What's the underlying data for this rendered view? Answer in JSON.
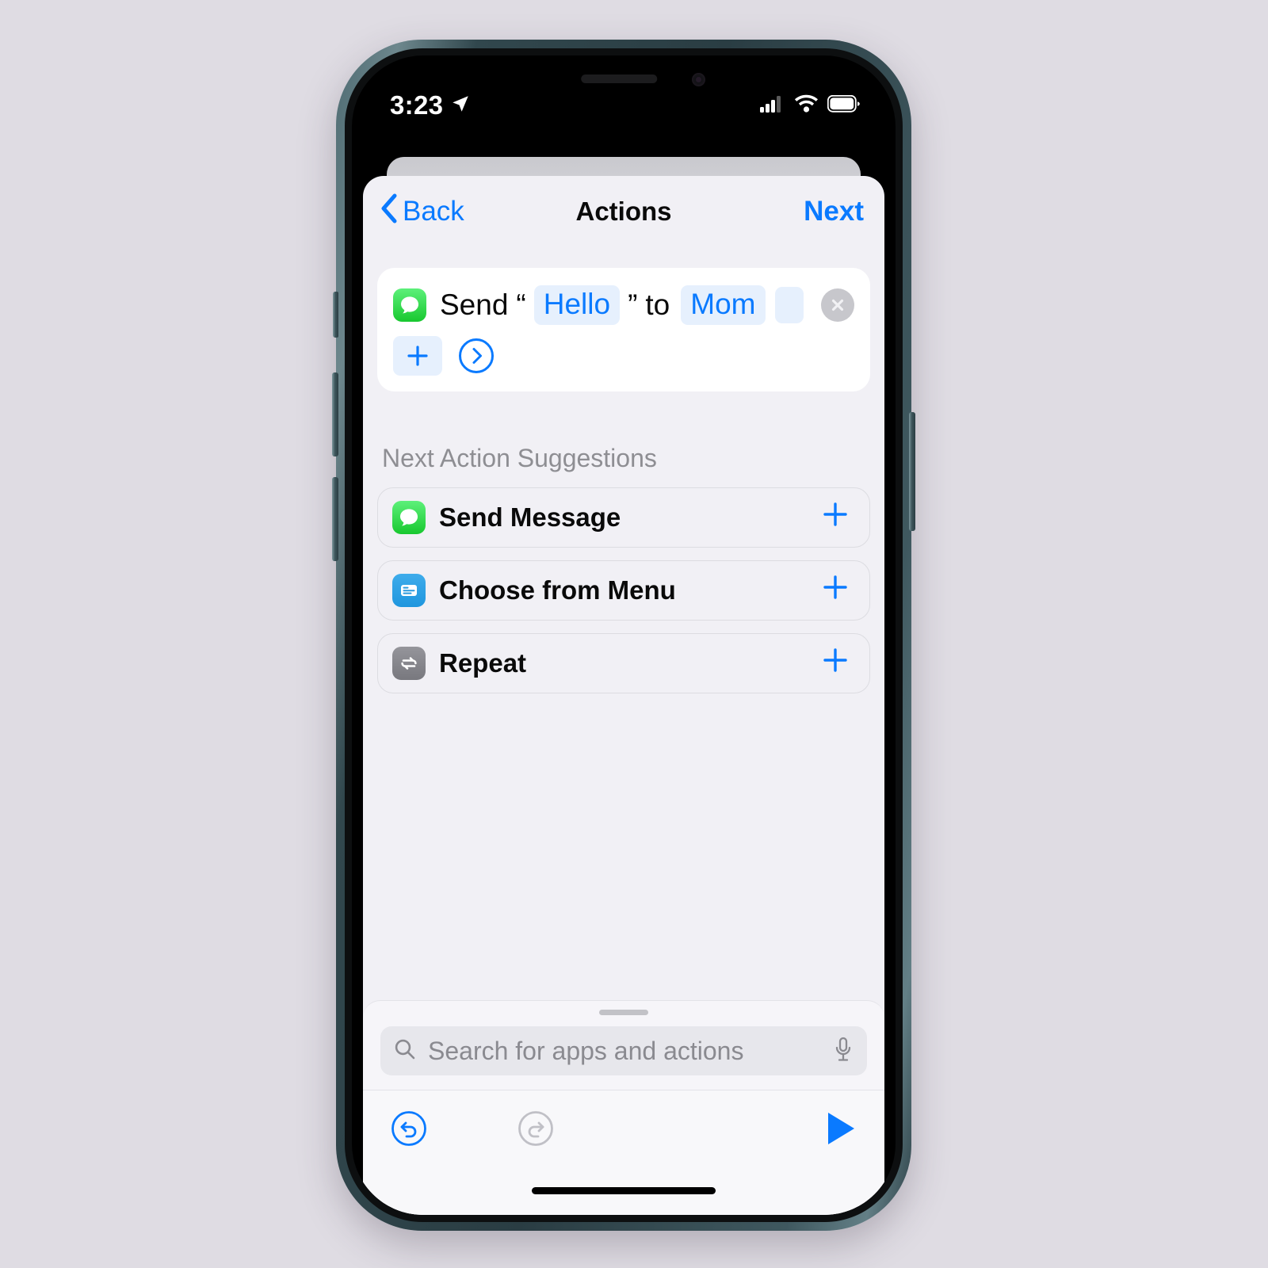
{
  "status_bar": {
    "time": "3:23",
    "location_icon": "location-arrow-icon",
    "cellular_icon": "cellular-signal-icon",
    "wifi_icon": "wifi-icon",
    "battery_icon": "battery-icon",
    "signal_bars_filled": 3,
    "signal_bars_total": 4
  },
  "nav": {
    "back_label": "Back",
    "title": "Actions",
    "next_label": "Next",
    "accent_color": "#0a7aff"
  },
  "action_card": {
    "app_icon": "messages-icon",
    "verb": "Send",
    "quote_open": "“",
    "message_value": "Hello",
    "quote_close": "”",
    "preposition": "to",
    "recipient_value": "Mom",
    "empty_field_value": "",
    "delete_icon": "close-circle-icon",
    "add_variable_icon": "plus-icon",
    "expand_icon": "chevron-right-circle-icon"
  },
  "suggestions": {
    "header": "Next Action Suggestions",
    "items": [
      {
        "label": "Send Message",
        "icon": "messages-icon",
        "add_icon": "plus-icon"
      },
      {
        "label": "Choose from Menu",
        "icon": "menu-card-icon",
        "add_icon": "plus-icon"
      },
      {
        "label": "Repeat",
        "icon": "repeat-icon",
        "add_icon": "plus-icon"
      }
    ]
  },
  "search": {
    "placeholder": "Search for apps and actions",
    "value": "",
    "search_icon": "search-icon",
    "dictate_icon": "microphone-icon"
  },
  "toolbar": {
    "undo_icon": "undo-icon",
    "undo_enabled": true,
    "redo_icon": "redo-icon",
    "redo_enabled": false,
    "play_icon": "play-icon",
    "enabled_color": "#0a7aff",
    "disabled_color": "#c0c0c6"
  }
}
